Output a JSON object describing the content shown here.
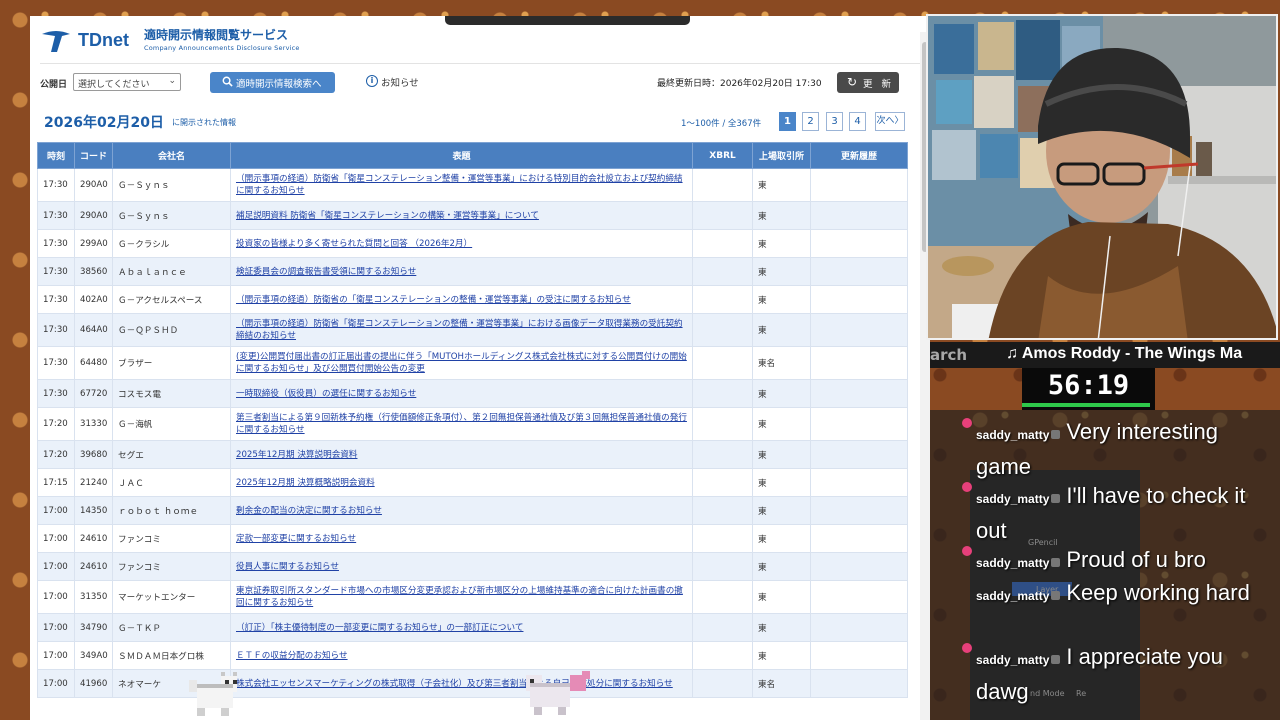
{
  "header": {
    "logo": "TDnet",
    "service_title": "適時開示情報閲覧サービス",
    "service_subtitle": "Company Announcements Disclosure Service"
  },
  "filters": {
    "date_label": "公開日",
    "date_select_value": "選択してください",
    "search_button": "適時開示情報検索へ",
    "notice_link": "お知らせ",
    "last_update": "最終更新日時：2026年02月20日 17:30",
    "refresh_button": "更 新"
  },
  "listing": {
    "date_heading": "2026年02月20日",
    "date_caption": "に開示された情報",
    "range_text": "1〜100件 / 全367件",
    "pages": [
      "1",
      "2",
      "3",
      "4"
    ],
    "next_label": "次へ"
  },
  "table": {
    "headers": [
      "時刻",
      "コード",
      "会社名",
      "表題",
      "XBRL",
      "上場取引所",
      "更新履歴"
    ],
    "rows": [
      {
        "time": "17:30",
        "code": "290A0",
        "company": "Ｇ－Ｓｙｎｓ",
        "title": "（開示事項の経過）防衛省「衛星コンステレーション整備・運営等事業」における特別目的会社設立および契約締結に関するお知らせ",
        "xbrl": "",
        "exchange": "東",
        "history": ""
      },
      {
        "time": "17:30",
        "code": "290A0",
        "company": "Ｇ－Ｓｙｎｓ",
        "title": "補足説明資料 防衛省「衛星コンステレーションの構築・運営等事業」について",
        "xbrl": "",
        "exchange": "東",
        "history": ""
      },
      {
        "time": "17:30",
        "code": "299A0",
        "company": "Ｇ－クラシル",
        "title": "投資家の皆様より多く寄せられた質問と回答 （2026年2月）",
        "xbrl": "",
        "exchange": "東",
        "history": ""
      },
      {
        "time": "17:30",
        "code": "38560",
        "company": "Ａｂａｌａｎｃｅ",
        "title": "検証委員会の調査報告書受領に関するお知らせ",
        "xbrl": "",
        "exchange": "東",
        "history": ""
      },
      {
        "time": "17:30",
        "code": "402A0",
        "company": "Ｇ－アクセルスペース",
        "title": "（開示事項の経過）防衛省の「衛星コンステレーションの整備・運営等事業」の受注に関するお知らせ",
        "xbrl": "",
        "exchange": "東",
        "history": ""
      },
      {
        "time": "17:30",
        "code": "464A0",
        "company": "Ｇ－ＱＰＳＨＤ",
        "title": "（開示事項の経過）防衛省「衛星コンステレーションの整備・運営等事業」における画像データ取得業務の受託契約締結のお知らせ",
        "xbrl": "",
        "exchange": "東",
        "history": ""
      },
      {
        "time": "17:30",
        "code": "64480",
        "company": "ブラザー",
        "title": "(変更)公開買付届出書の訂正届出書の提出に伴う「MUTOHホールディングス株式会社株式に対する公開買付けの開始に関するお知らせ」及び公開買付開始公告の変更",
        "xbrl": "",
        "exchange": "東名",
        "history": ""
      },
      {
        "time": "17:30",
        "code": "67720",
        "company": "コスモス電",
        "title": "一時取締役（仮役員）の選任に関するお知らせ",
        "xbrl": "",
        "exchange": "東",
        "history": ""
      },
      {
        "time": "17:20",
        "code": "31330",
        "company": "Ｇ－海帆",
        "title": "第三者割当による第９回新株予約権（行使価額修正条項付）、第２回無担保普通社債及び第３回無担保普通社債の発行に関するお知らせ",
        "xbrl": "",
        "exchange": "東",
        "history": ""
      },
      {
        "time": "17:20",
        "code": "39680",
        "company": "セグエ",
        "title": "2025年12月期 決算説明会資料",
        "xbrl": "",
        "exchange": "東",
        "history": ""
      },
      {
        "time": "17:15",
        "code": "21240",
        "company": "ＪＡＣ",
        "title": "2025年12月期 決算概略説明会資料",
        "xbrl": "",
        "exchange": "東",
        "history": ""
      },
      {
        "time": "17:00",
        "code": "14350",
        "company": "ｒｏｂｏｔ ｈｏｍｅ",
        "title": "剰余金の配当の決定に関するお知らせ",
        "xbrl": "",
        "exchange": "東",
        "history": ""
      },
      {
        "time": "17:00",
        "code": "24610",
        "company": "ファンコミ",
        "title": "定款一部変更に関するお知らせ",
        "xbrl": "",
        "exchange": "東",
        "history": ""
      },
      {
        "time": "17:00",
        "code": "24610",
        "company": "ファンコミ",
        "title": "役員人事に関するお知らせ",
        "xbrl": "",
        "exchange": "東",
        "history": ""
      },
      {
        "time": "17:00",
        "code": "31350",
        "company": "マーケットエンター",
        "title": "東京証券取引所スタンダード市場への市場区分変更承認および新市場区分の上場維持基準の適合に向けた計画書の撤回に関するお知らせ",
        "xbrl": "",
        "exchange": "東",
        "history": ""
      },
      {
        "time": "17:00",
        "code": "34790",
        "company": "Ｇ－ＴＫＰ",
        "title": "（訂正）「株主優待制度の一部変更に関するお知らせ」の一部訂正について",
        "xbrl": "",
        "exchange": "東",
        "history": ""
      },
      {
        "time": "17:00",
        "code": "349A0",
        "company": "ＳＭＤＡＭ日本グロ株",
        "title": "ＥＴＦの収益分配のお知らせ",
        "xbrl": "",
        "exchange": "東",
        "history": ""
      },
      {
        "time": "17:00",
        "code": "41960",
        "company": "ネオマーケ",
        "title": "株式会社エッセンスマーケティングの株式取得（子会社化）及び第三者割当による自己株式処分に関するお知らせ",
        "xbrl": "",
        "exchange": "東名",
        "history": ""
      }
    ]
  },
  "stream": {
    "music_clipped": "arch",
    "music_now_playing": "♫ Amos Roddy - The Wings Ma",
    "timer": "56:19",
    "timer_progress": 0.96,
    "background_labels": [
      "GPencil",
      "Layer",
      "nd Mode",
      "Re"
    ],
    "chat": [
      {
        "user": "saddy_matty",
        "message": "Very interesting game"
      },
      {
        "user": "saddy_matty",
        "message": "I'll have to check it out"
      },
      {
        "user": "saddy_matty",
        "message": "Proud of u bro"
      },
      {
        "user": "saddy_matty",
        "message": "Keep working hard"
      },
      {
        "user": "saddy_matty",
        "message": "I appreciate you dawg"
      }
    ]
  },
  "colors": {
    "tdnet_blue": "#1d5ea8",
    "table_header": "#4a7fc0",
    "row_alt": "#eaf1fa",
    "link": "#2042a6",
    "timer_bar": "#2ec84a",
    "chat_dot": "#e8407a"
  },
  "icons": [
    "tdnet-logo-icon",
    "search-icon",
    "info-icon",
    "refresh-icon",
    "chevron-down-icon",
    "music-note-icon",
    "chat-dot-icon"
  ]
}
